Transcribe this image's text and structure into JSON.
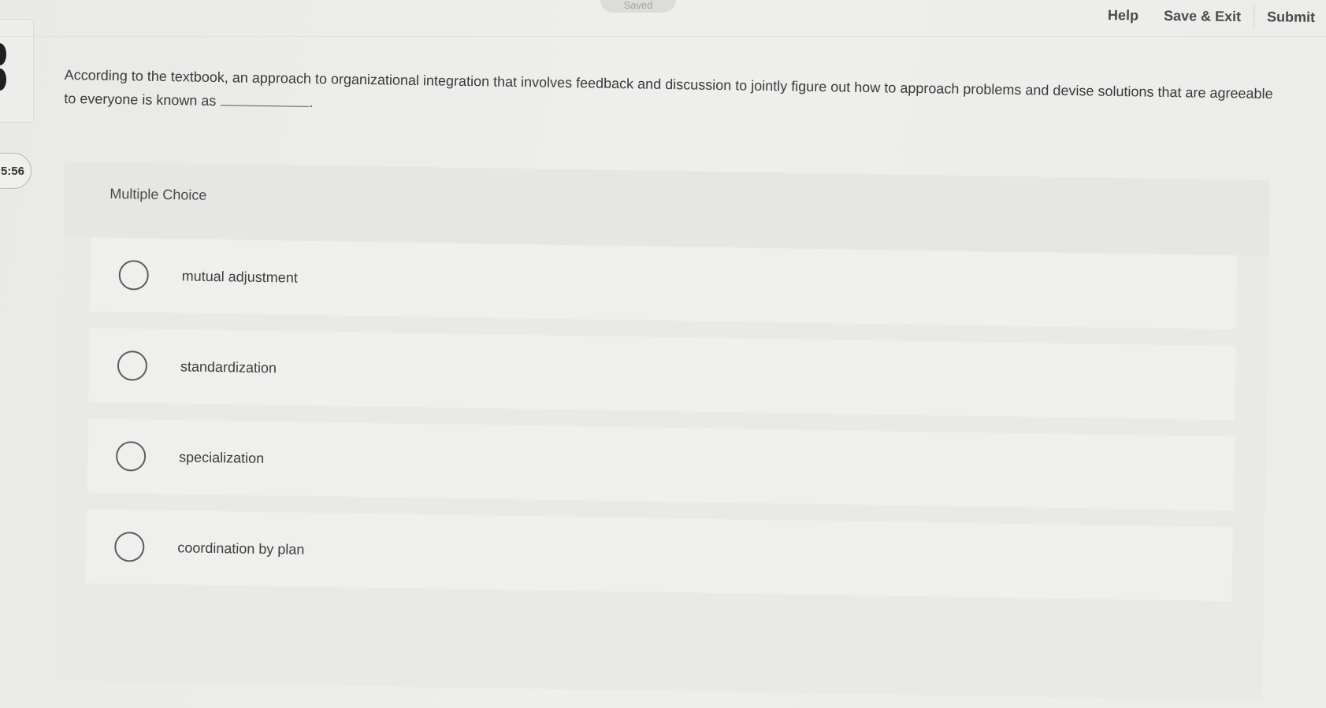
{
  "header": {
    "saved_label": "Saved",
    "nav": {
      "help": "Help",
      "save_exit": "Save & Exit",
      "submit": "Submit"
    }
  },
  "timer": {
    "value": "5:56"
  },
  "question": {
    "text": "According to the textbook, an approach to organizational integration that involves feedback and discussion to jointly figure out how to approach problems and devise solutions that are agreeable to everyone is known as",
    "end_punct": "."
  },
  "answer_card": {
    "type_label": "Multiple Choice",
    "options": [
      {
        "label": "mutual adjustment",
        "selected": false
      },
      {
        "label": "standardization",
        "selected": false
      },
      {
        "label": "specialization",
        "selected": false
      },
      {
        "label": "coordination by plan",
        "selected": false
      }
    ]
  }
}
